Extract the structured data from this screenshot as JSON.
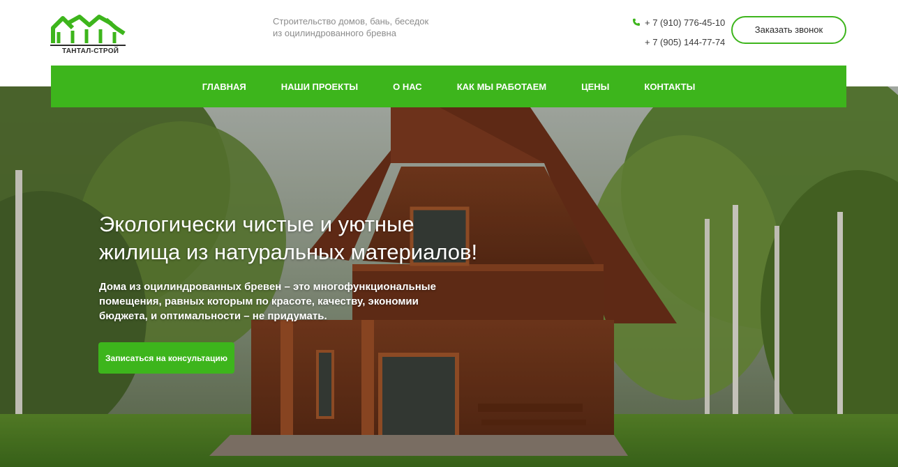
{
  "brand": {
    "name": "ТАНТАЛ-СТРОЙ",
    "logo_icon": "houses-roofs-icon",
    "accent_color": "#3db51c"
  },
  "header": {
    "tagline_line1": "Строительство домов, бань, беседок",
    "tagline_line2": "из оцилиндрованного бревна",
    "phone_icon": "phone-icon",
    "phone1": "+ 7 (910) 776-45-10",
    "phone2": "+ 7 (905) 144-77-74",
    "callback_label": "Заказать звонок"
  },
  "nav": {
    "items": [
      {
        "label": "ГЛАВНАЯ"
      },
      {
        "label": "НАШИ ПРОЕКТЫ"
      },
      {
        "label": "О НАС"
      },
      {
        "label": "КАК МЫ РАБОТАЕМ"
      },
      {
        "label": "ЦЕНЫ"
      },
      {
        "label": "КОНТАКТЫ"
      }
    ]
  },
  "hero": {
    "title_line1": "Экологически чистые и уютные",
    "title_line2": "жилища из натуральных материалов!",
    "desc_line1": "Дома из оцилиндрованных бревен – это многофункциональные",
    "desc_line2": "помещения, равных которым по красоте, качеству, экономии",
    "desc_line3": "бюджета, и оптимальности – не придумать.",
    "cta_label": "Записаться на консультацию"
  }
}
